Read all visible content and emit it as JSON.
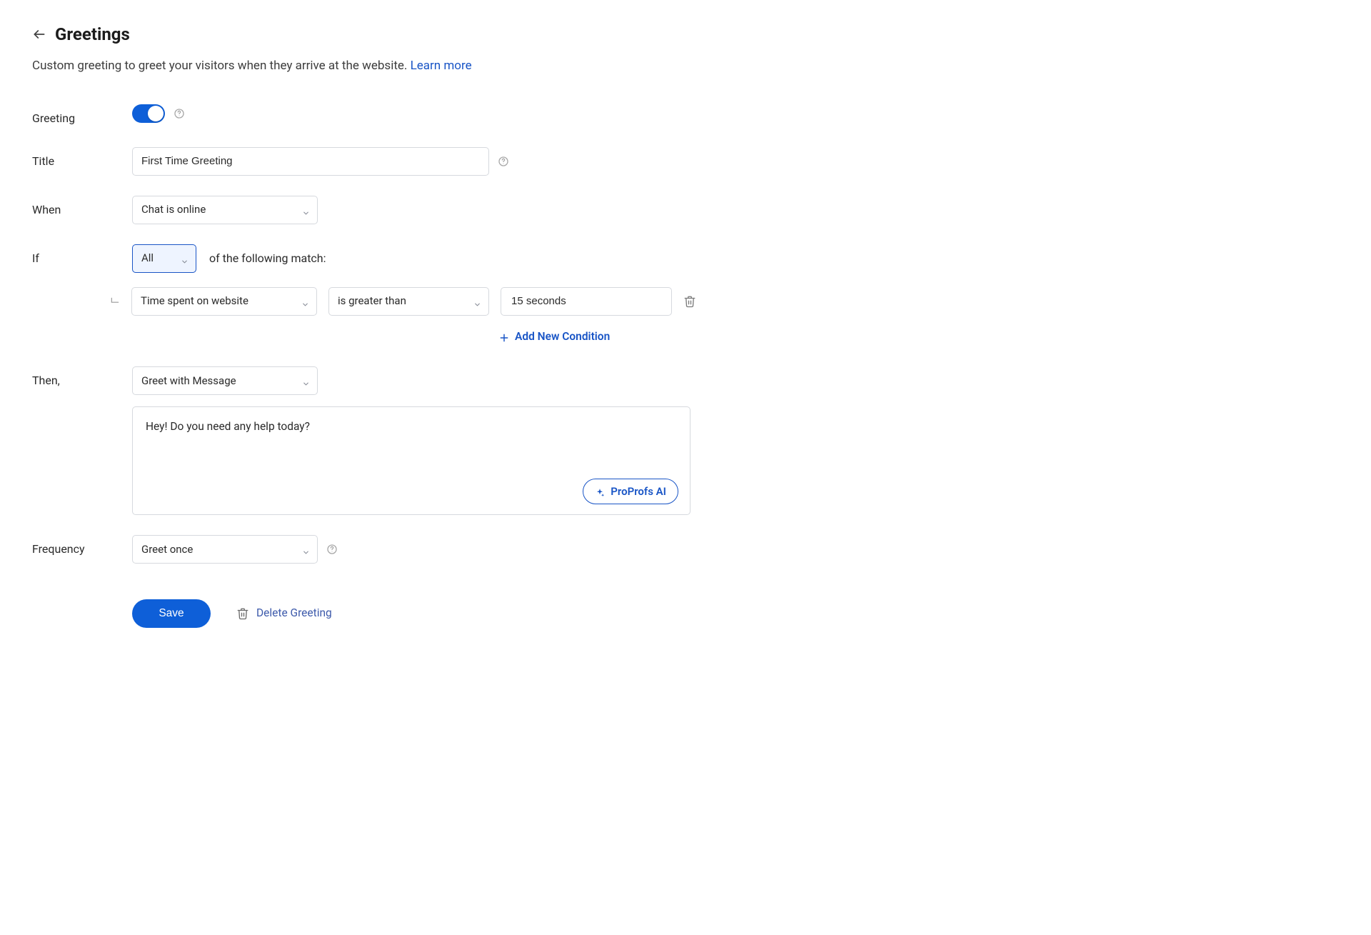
{
  "header": {
    "title": "Greetings",
    "subtitle": "Custom greeting to greet your visitors when they arrive at the website. ",
    "learn_more": "Learn more"
  },
  "form": {
    "greeting_label": "Greeting",
    "title_label": "Title",
    "title_value": "First Time Greeting",
    "when_label": "When",
    "when_value": "Chat is online",
    "if_label": "If",
    "if_match_mode": "All",
    "if_sentence_suffix": "of the following match:",
    "condition": {
      "field": "Time spent on website",
      "operator": "is greater than",
      "value": "15 seconds"
    },
    "add_condition_label": "Add New Condition",
    "then_label": "Then,",
    "then_action": "Greet with Message",
    "message": "Hey! Do you need any help today?",
    "ai_button_label": "ProProfs AI",
    "frequency_label": "Frequency",
    "frequency_value": "Greet once",
    "save_label": "Save",
    "delete_label": "Delete Greeting"
  }
}
